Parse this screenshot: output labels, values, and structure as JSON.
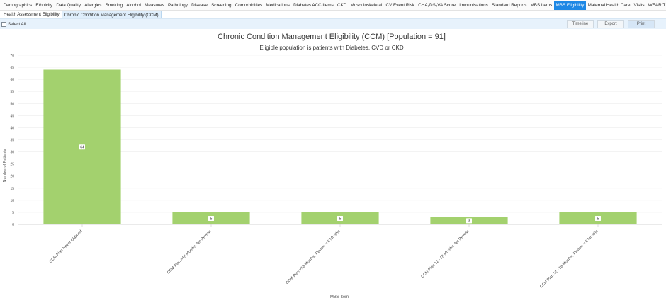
{
  "top_tabs": [
    {
      "label": "Demographics",
      "active": false
    },
    {
      "label": "Ethnicity",
      "active": false
    },
    {
      "label": "Data Quality",
      "active": false
    },
    {
      "label": "Allergies",
      "active": false
    },
    {
      "label": "Smoking",
      "active": false
    },
    {
      "label": "Alcohol",
      "active": false
    },
    {
      "label": "Measures",
      "active": false
    },
    {
      "label": "Pathology",
      "active": false
    },
    {
      "label": "Disease",
      "active": false
    },
    {
      "label": "Screening",
      "active": false
    },
    {
      "label": "Comorbidities",
      "active": false
    },
    {
      "label": "Medications",
      "active": false
    },
    {
      "label": "Diabetes ACC Items",
      "active": false
    },
    {
      "label": "CKD",
      "active": false
    },
    {
      "label": "Musculoskeletal",
      "active": false
    },
    {
      "label": "CV Event Risk",
      "active": false
    },
    {
      "label": "CHA₂DS₂VA Score",
      "active": false
    },
    {
      "label": "Immunisations",
      "active": false
    },
    {
      "label": "Standard Reports",
      "active": false
    },
    {
      "label": "MBS Items",
      "active": false
    },
    {
      "label": "MBS Eligibility",
      "active": true
    },
    {
      "label": "Maternal Health Care",
      "active": false
    },
    {
      "label": "Visits",
      "active": false
    },
    {
      "label": "WEARIT",
      "active": false
    }
  ],
  "top_scroll_icon": "‹",
  "sub_tabs": [
    {
      "label": "Health Assessment Eligibility",
      "active": false
    },
    {
      "label": "Chronic Condition Management Eligibility (CCM)",
      "active": true
    }
  ],
  "toolbar": {
    "select_all": "Select All",
    "timeline": "Timeline",
    "export": "Export",
    "print": "Print"
  },
  "colors": {
    "bar": "#a3d16e",
    "active_tab": "#1e88e5",
    "toolbar_bg": "#e7f2fc"
  },
  "chart_data": {
    "type": "bar",
    "title": "Chronic Condition Management Eligibility (CCM) [Population = 91]",
    "subtitle": "Eligible population is patients with Diabetes, CVD or CKD",
    "xlabel": "MBS Item",
    "ylabel": "Number of Patients",
    "ylim": [
      0,
      70
    ],
    "yticks": [
      0,
      5,
      10,
      15,
      20,
      25,
      30,
      35,
      40,
      45,
      50,
      55,
      60,
      65,
      70
    ],
    "categories": [
      "CCM Plan Never Claimed",
      "CCM Plan >18 Months, No Review",
      "CCM Plan >18 Months, Review < 6 Months",
      "CCM Plan 12 - 18 Months, No Review",
      "CCM Plan 12 - 18 Months, Review < 6 Months"
    ],
    "values": [
      64,
      5,
      5,
      3,
      5
    ],
    "data_labels": [
      "64",
      "5",
      "5",
      "3",
      "5"
    ],
    "grid": true,
    "legend": "none"
  }
}
